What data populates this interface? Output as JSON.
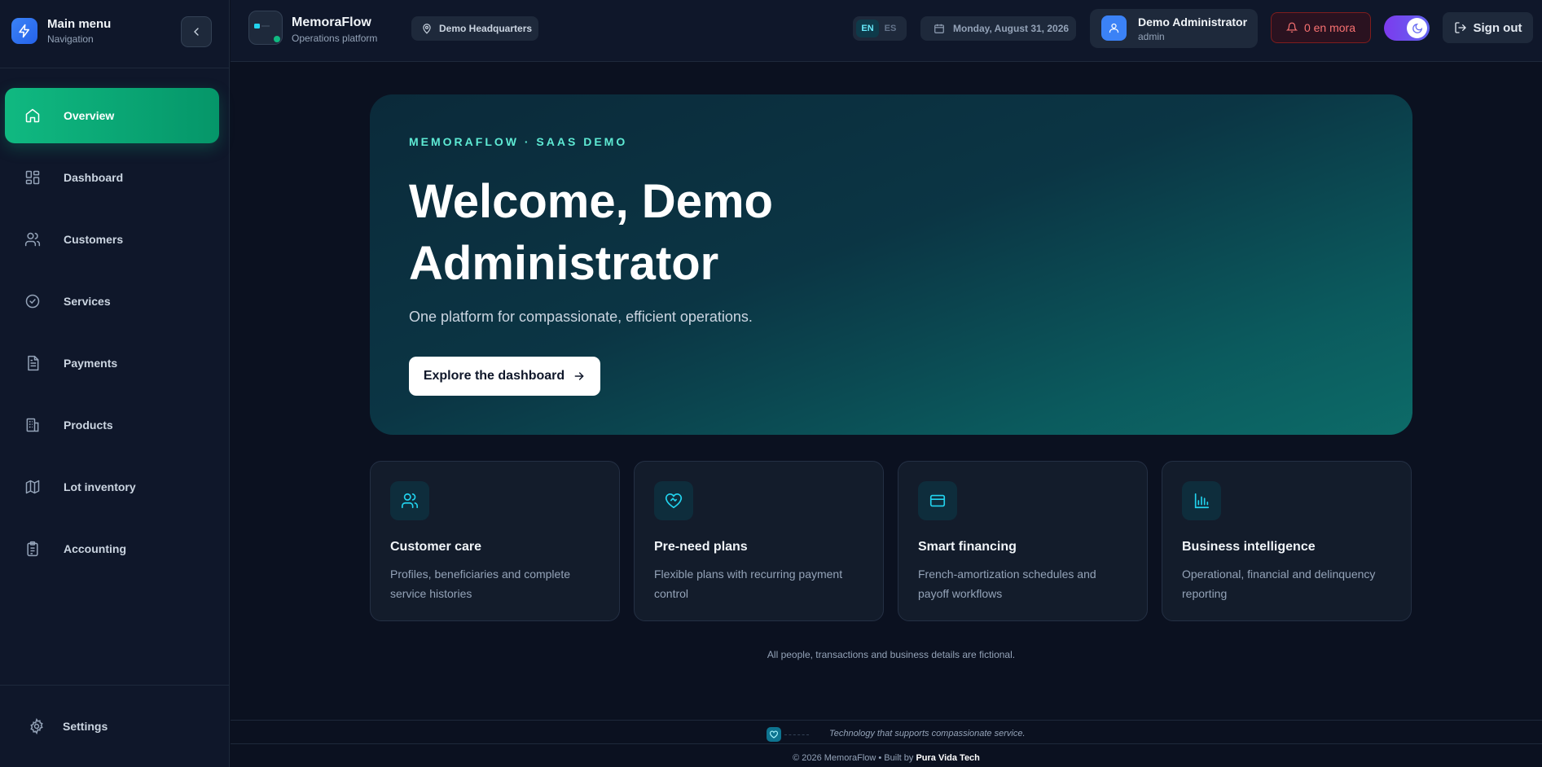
{
  "sidebar": {
    "title": "Main menu",
    "subtitle": "Navigation",
    "items": [
      {
        "label": "Overview",
        "icon": "home-icon"
      },
      {
        "label": "Dashboard",
        "icon": "dashboard-grid-icon"
      },
      {
        "label": "Customers",
        "icon": "users-icon"
      },
      {
        "label": "Services",
        "icon": "check-circle-icon"
      },
      {
        "label": "Payments",
        "icon": "document-icon"
      },
      {
        "label": "Products",
        "icon": "building-icon"
      },
      {
        "label": "Lot inventory",
        "icon": "map-icon"
      },
      {
        "label": "Accounting",
        "icon": "clipboard-icon"
      }
    ],
    "settings_label": "Settings"
  },
  "header": {
    "brand_name": "MemoraFlow",
    "brand_sub": "Operations platform",
    "location": "Demo Headquarters",
    "lang_en": "EN",
    "lang_es": "ES",
    "date": "Monday, August 31, 2026",
    "user_name": "Demo Administrator",
    "user_role": "admin",
    "mora_label": "0 en mora",
    "signout_label": "Sign out"
  },
  "hero": {
    "eyebrow": "MEMORAFLOW · SAAS DEMO",
    "title": "Welcome, Demo Administrator",
    "description": "One platform for compassionate, efficient operations.",
    "cta": "Explore the dashboard"
  },
  "features": [
    {
      "title": "Customer care",
      "desc": "Profiles, beneficiaries and complete service histories",
      "icon": "users-icon"
    },
    {
      "title": "Pre-need plans",
      "desc": "Flexible plans with recurring payment control",
      "icon": "heart-handshake-icon"
    },
    {
      "title": "Smart financing",
      "desc": "French-amortization schedules and payoff workflows",
      "icon": "credit-card-icon"
    },
    {
      "title": "Business intelligence",
      "desc": "Operational, financial and delinquency reporting",
      "icon": "bar-chart-icon"
    }
  ],
  "disclaimer": "All people, transactions and business details are fictional.",
  "footer": {
    "tagline": "Technology that supports compassionate service.",
    "copyright": "© 2026 MemoraFlow • Built by",
    "builder": "Pura Vida Tech"
  },
  "colors": {
    "accent": "#10b981",
    "background": "#0b1120",
    "alert": "#f87171",
    "toggle": "#7c3aed"
  }
}
